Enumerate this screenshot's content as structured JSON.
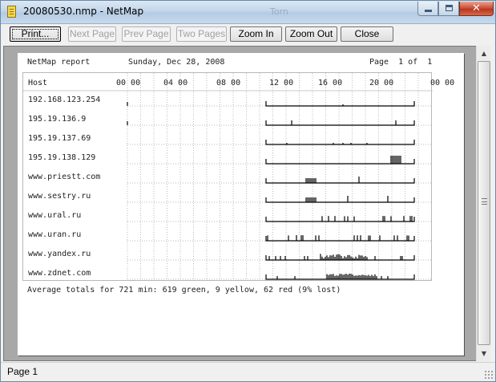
{
  "window": {
    "title": "20080530.nmp - NetMap",
    "background_title": "Torn"
  },
  "toolbar": {
    "print": "Print...",
    "next_page": "Next Page",
    "prev_page": "Prev Page",
    "two_pages": "Two Pages",
    "zoom_in": "Zoom In",
    "zoom_out": "Zoom Out",
    "close": "Close"
  },
  "report": {
    "title": "NetMap report",
    "date": "Sunday, Dec 28, 2008",
    "page_label": "Page  1 of  1",
    "host_header": "Host",
    "hour_labels": [
      "00 00",
      "04 00",
      "08 00",
      "12 00",
      "16 00",
      "20 00",
      "00 00"
    ],
    "hosts": [
      {
        "name": "192.168.123.254",
        "profile": "flat"
      },
      {
        "name": "195.19.136.9",
        "profile": "sparse"
      },
      {
        "name": "195.19.137.69",
        "profile": "flat2"
      },
      {
        "name": "195.19.138.129",
        "profile": "step"
      },
      {
        "name": "www.priestt.com",
        "profile": "busy"
      },
      {
        "name": "www.sestry.ru",
        "profile": "busy2"
      },
      {
        "name": "www.ural.ru",
        "profile": "noisy"
      },
      {
        "name": "www.uran.ru",
        "profile": "noisy2"
      },
      {
        "name": "www.yandex.ru",
        "profile": "heavy"
      },
      {
        "name": "www.zdnet.com",
        "profile": "dense"
      }
    ],
    "totals": "Average totals for 721 min: 619 green, 9 yellow, 62 red (9% lost)"
  },
  "status": {
    "page": "Page 1"
  },
  "colors": {
    "page_bg": "#ffffff",
    "preview_bg": "#a8a8a8",
    "trace": "#000000",
    "grid_dots": "#bbbbbb"
  }
}
